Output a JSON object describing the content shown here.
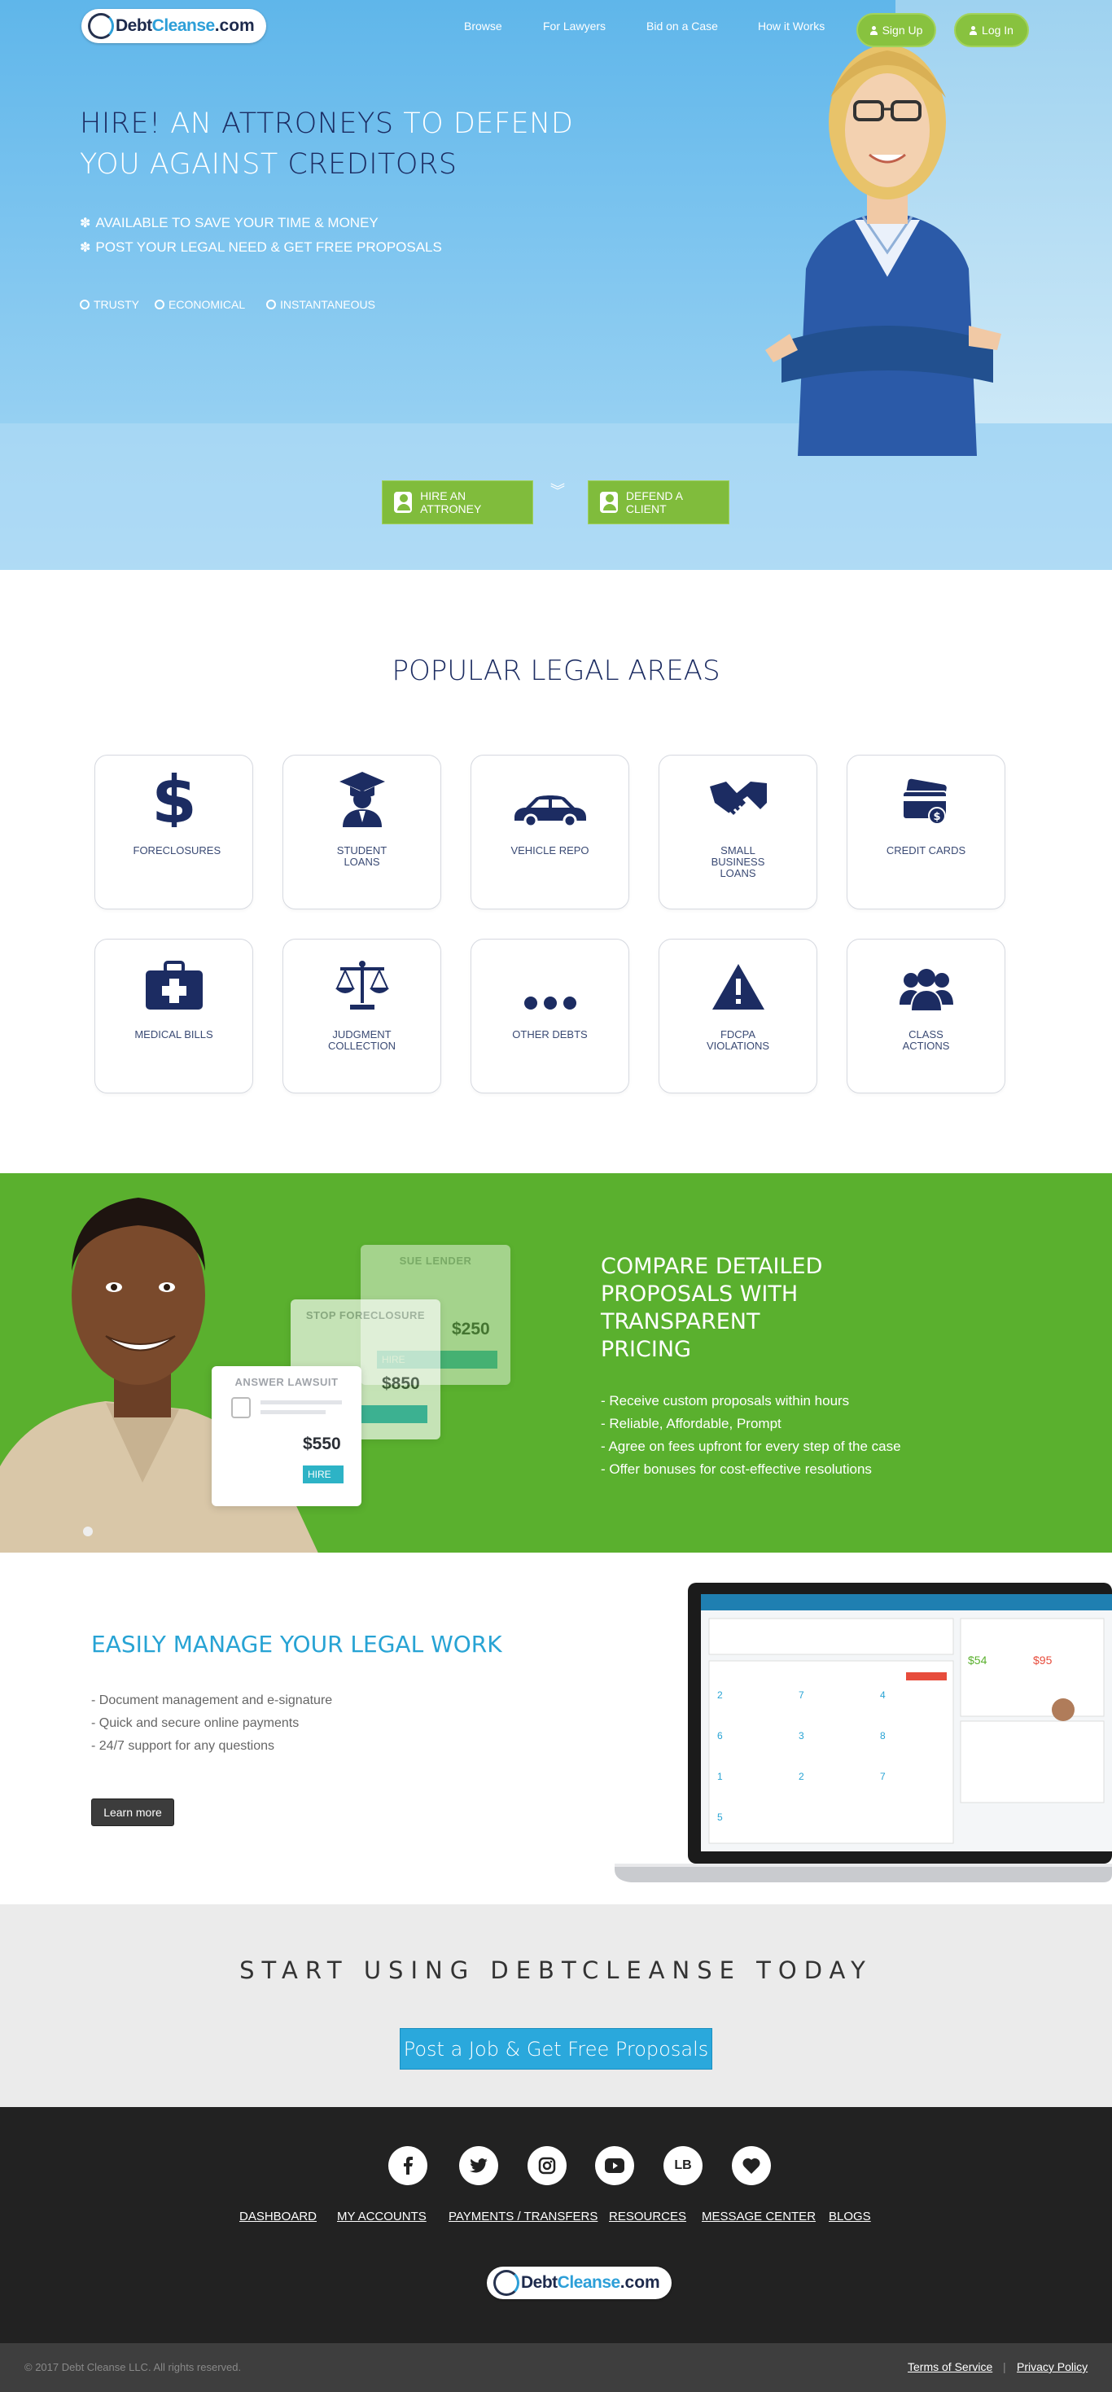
{
  "header": {
    "logo": {
      "debt": "Debt",
      "cleanse": "Cleanse",
      "com": ".com"
    },
    "nav": [
      "Browse",
      "For Lawyers",
      "Bid on a Case",
      "How it Works"
    ],
    "signup": "Sign Up",
    "login": "Log In"
  },
  "hero": {
    "line1_a": "HIRE!",
    "line1_b": "AN",
    "line1_c": "ATTRONEYS",
    "line1_d": "TO DEFEND",
    "line2_a": "YOU AGAINST",
    "line2_b": "CREDITORS",
    "bullets": [
      "AVAILABLE TO SAVE YOUR TIME & MONEY",
      "POST YOUR LEGAL NEED & GET FREE PROPOSALS"
    ],
    "features": [
      "TRUSTY",
      "ECONOMICAL",
      "INSTANTANEOUS"
    ],
    "hire_btn": "HIRE AN ATTRONEY",
    "defend_btn": "DEFEND A CLIENT"
  },
  "popular": {
    "title": "POPULAR LEGAL AREAS",
    "areas": [
      {
        "label": "FORECLOSURES",
        "icon": "dollar-icon"
      },
      {
        "label": "STUDENT LOANS",
        "icon": "graduate-icon"
      },
      {
        "label": "VEHICLE REPO",
        "icon": "car-icon"
      },
      {
        "label": "SMALL BUSINESS LOANS",
        "icon": "handshake-icon"
      },
      {
        "label": "CREDIT CARDS",
        "icon": "credit-card-icon"
      },
      {
        "label": "MEDICAL BILLS",
        "icon": "medical-kit-icon"
      },
      {
        "label": "JUDGMENT COLLECTION",
        "icon": "scales-icon"
      },
      {
        "label": "OTHER DEBTS",
        "icon": "ellipsis-icon"
      },
      {
        "label": "FDCPA VIOLATIONS",
        "icon": "warning-icon"
      },
      {
        "label": "CLASS ACTIONS",
        "icon": "group-icon"
      }
    ]
  },
  "compare": {
    "title_lines": [
      "COMPARE DETAILED",
      "PROPOSALS WITH",
      "TRANSPARENT",
      "PRICING"
    ],
    "items": [
      "- Receive custom proposals within hours",
      "- Reliable, Affordable, Prompt",
      "- Agree on fees upfront for every step of the case",
      "- Offer bonuses for cost-effective resolutions"
    ],
    "cards": [
      {
        "title": "SUE LENDER",
        "price": "$250",
        "btn": "HIRE"
      },
      {
        "title": "STOP FORECLOSURE",
        "price": "$850",
        "btn": "HIRE"
      },
      {
        "title": "ANSWER LAWSUIT",
        "price": "$550",
        "btn": "HIRE"
      }
    ]
  },
  "manage": {
    "title": "EASILY MANAGE YOUR LEGAL WORK",
    "items": [
      "- Document management and e-signature",
      "- Quick and secure online payments",
      "- 24/7 support for any questions"
    ],
    "learn_more": "Learn more"
  },
  "start": {
    "title": "START USING DEBTCLEANSE TODAY",
    "cta": "Post a Job & Get Free Proposals"
  },
  "footer": {
    "social": [
      "facebook-icon",
      "twitter-icon",
      "instagram-icon",
      "youtube-icon",
      "lb-icon",
      "heart-icon"
    ],
    "lb_text": "LB",
    "links": [
      "DASHBOARD",
      "MY ACCOUNTS",
      "PAYMENTS / TRANSFERS",
      "RESOURCES",
      "MESSAGE CENTER",
      "BLOGS"
    ],
    "copyright": "© 2017 Debt Cleanse LLC. All rights reserved.",
    "terms": "Terms of Service",
    "separator": "|",
    "privacy": "Privacy Policy"
  },
  "colors": {
    "navy": "#1c2c62",
    "green": "#80bc3c",
    "section_green": "#5ab02e",
    "blue": "#2aa8dc"
  }
}
